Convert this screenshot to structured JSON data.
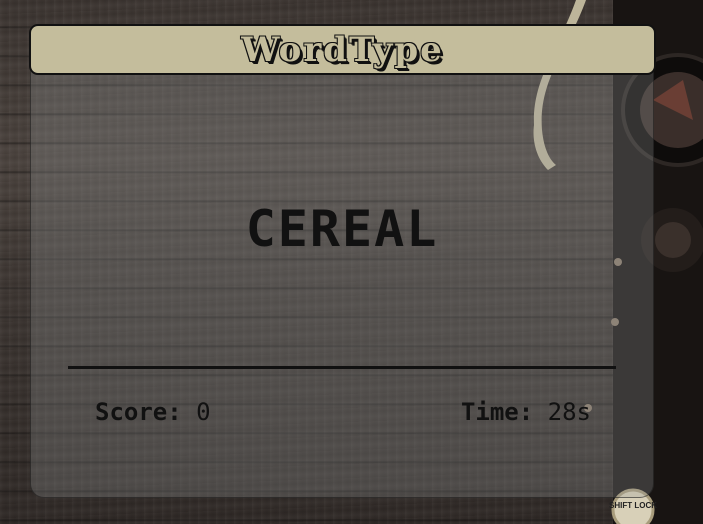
{
  "app": {
    "title": "WordType"
  },
  "game": {
    "current_word": "CEREAL",
    "score_label": "Score:",
    "score_value": "0",
    "time_label": "Time:",
    "time_value": "28s"
  },
  "decor": {
    "shift_lock_key_label": "SHIFT LOCK"
  },
  "colors": {
    "title_bar": "#c4bd9c",
    "text": "#111111",
    "wood": "#3b3430"
  }
}
